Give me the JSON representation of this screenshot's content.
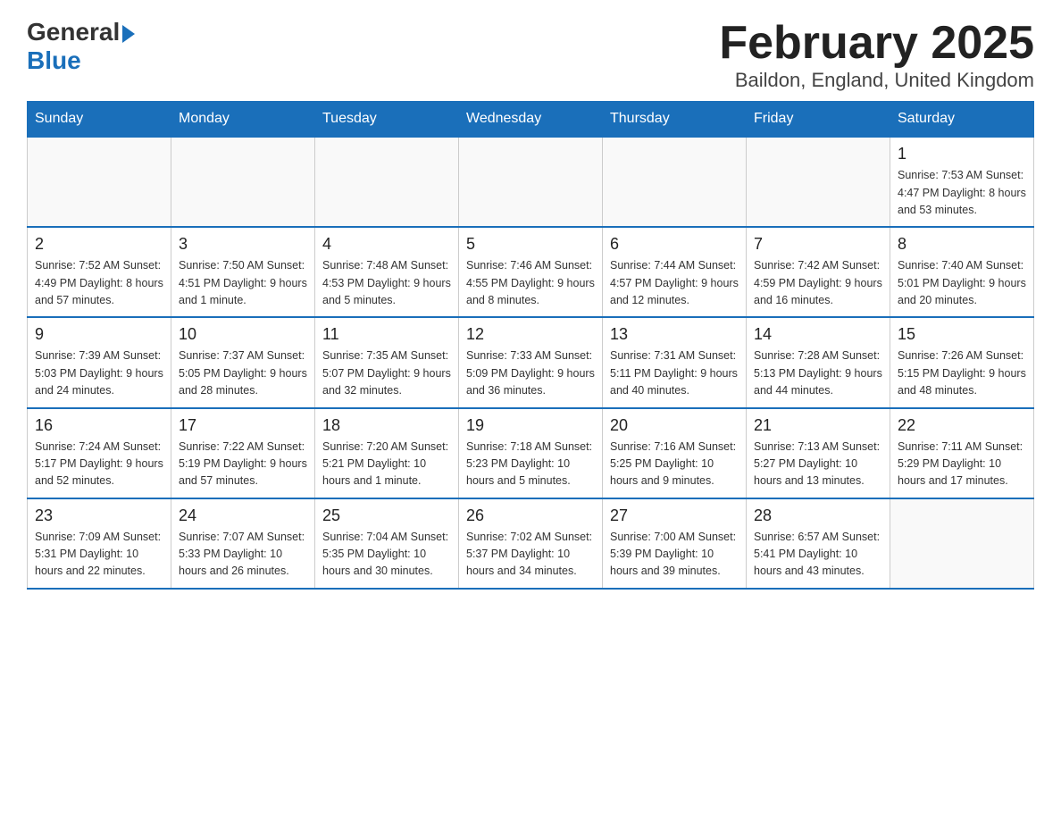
{
  "header": {
    "logo_general": "General",
    "logo_blue": "Blue",
    "month_title": "February 2025",
    "location": "Baildon, England, United Kingdom"
  },
  "days_of_week": [
    "Sunday",
    "Monday",
    "Tuesday",
    "Wednesday",
    "Thursday",
    "Friday",
    "Saturday"
  ],
  "weeks": [
    [
      {
        "day": "",
        "info": ""
      },
      {
        "day": "",
        "info": ""
      },
      {
        "day": "",
        "info": ""
      },
      {
        "day": "",
        "info": ""
      },
      {
        "day": "",
        "info": ""
      },
      {
        "day": "",
        "info": ""
      },
      {
        "day": "1",
        "info": "Sunrise: 7:53 AM\nSunset: 4:47 PM\nDaylight: 8 hours and 53 minutes."
      }
    ],
    [
      {
        "day": "2",
        "info": "Sunrise: 7:52 AM\nSunset: 4:49 PM\nDaylight: 8 hours and 57 minutes."
      },
      {
        "day": "3",
        "info": "Sunrise: 7:50 AM\nSunset: 4:51 PM\nDaylight: 9 hours and 1 minute."
      },
      {
        "day": "4",
        "info": "Sunrise: 7:48 AM\nSunset: 4:53 PM\nDaylight: 9 hours and 5 minutes."
      },
      {
        "day": "5",
        "info": "Sunrise: 7:46 AM\nSunset: 4:55 PM\nDaylight: 9 hours and 8 minutes."
      },
      {
        "day": "6",
        "info": "Sunrise: 7:44 AM\nSunset: 4:57 PM\nDaylight: 9 hours and 12 minutes."
      },
      {
        "day": "7",
        "info": "Sunrise: 7:42 AM\nSunset: 4:59 PM\nDaylight: 9 hours and 16 minutes."
      },
      {
        "day": "8",
        "info": "Sunrise: 7:40 AM\nSunset: 5:01 PM\nDaylight: 9 hours and 20 minutes."
      }
    ],
    [
      {
        "day": "9",
        "info": "Sunrise: 7:39 AM\nSunset: 5:03 PM\nDaylight: 9 hours and 24 minutes."
      },
      {
        "day": "10",
        "info": "Sunrise: 7:37 AM\nSunset: 5:05 PM\nDaylight: 9 hours and 28 minutes."
      },
      {
        "day": "11",
        "info": "Sunrise: 7:35 AM\nSunset: 5:07 PM\nDaylight: 9 hours and 32 minutes."
      },
      {
        "day": "12",
        "info": "Sunrise: 7:33 AM\nSunset: 5:09 PM\nDaylight: 9 hours and 36 minutes."
      },
      {
        "day": "13",
        "info": "Sunrise: 7:31 AM\nSunset: 5:11 PM\nDaylight: 9 hours and 40 minutes."
      },
      {
        "day": "14",
        "info": "Sunrise: 7:28 AM\nSunset: 5:13 PM\nDaylight: 9 hours and 44 minutes."
      },
      {
        "day": "15",
        "info": "Sunrise: 7:26 AM\nSunset: 5:15 PM\nDaylight: 9 hours and 48 minutes."
      }
    ],
    [
      {
        "day": "16",
        "info": "Sunrise: 7:24 AM\nSunset: 5:17 PM\nDaylight: 9 hours and 52 minutes."
      },
      {
        "day": "17",
        "info": "Sunrise: 7:22 AM\nSunset: 5:19 PM\nDaylight: 9 hours and 57 minutes."
      },
      {
        "day": "18",
        "info": "Sunrise: 7:20 AM\nSunset: 5:21 PM\nDaylight: 10 hours and 1 minute."
      },
      {
        "day": "19",
        "info": "Sunrise: 7:18 AM\nSunset: 5:23 PM\nDaylight: 10 hours and 5 minutes."
      },
      {
        "day": "20",
        "info": "Sunrise: 7:16 AM\nSunset: 5:25 PM\nDaylight: 10 hours and 9 minutes."
      },
      {
        "day": "21",
        "info": "Sunrise: 7:13 AM\nSunset: 5:27 PM\nDaylight: 10 hours and 13 minutes."
      },
      {
        "day": "22",
        "info": "Sunrise: 7:11 AM\nSunset: 5:29 PM\nDaylight: 10 hours and 17 minutes."
      }
    ],
    [
      {
        "day": "23",
        "info": "Sunrise: 7:09 AM\nSunset: 5:31 PM\nDaylight: 10 hours and 22 minutes."
      },
      {
        "day": "24",
        "info": "Sunrise: 7:07 AM\nSunset: 5:33 PM\nDaylight: 10 hours and 26 minutes."
      },
      {
        "day": "25",
        "info": "Sunrise: 7:04 AM\nSunset: 5:35 PM\nDaylight: 10 hours and 30 minutes."
      },
      {
        "day": "26",
        "info": "Sunrise: 7:02 AM\nSunset: 5:37 PM\nDaylight: 10 hours and 34 minutes."
      },
      {
        "day": "27",
        "info": "Sunrise: 7:00 AM\nSunset: 5:39 PM\nDaylight: 10 hours and 39 minutes."
      },
      {
        "day": "28",
        "info": "Sunrise: 6:57 AM\nSunset: 5:41 PM\nDaylight: 10 hours and 43 minutes."
      },
      {
        "day": "",
        "info": ""
      }
    ]
  ]
}
